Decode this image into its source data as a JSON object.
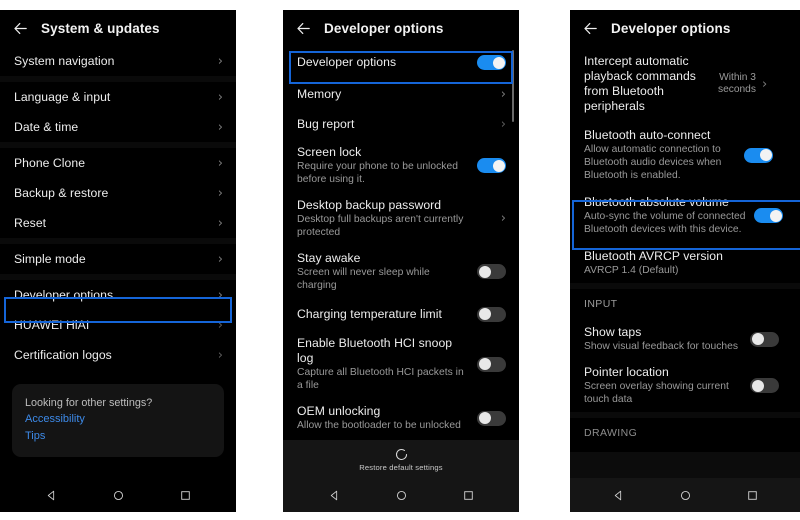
{
  "theme": {
    "accent_blue": "#1a8cf0",
    "highlight_border": "#1565d8",
    "link_blue": "#3d8ae8",
    "background": "#000000",
    "toggle_off": "#3a3a3a"
  },
  "panel1": {
    "header": {
      "back_icon": "back-arrow-icon",
      "title": "System & updates"
    },
    "groups": [
      {
        "items": [
          {
            "title": "System navigation",
            "accessory": "chevron"
          }
        ]
      },
      {
        "items": [
          {
            "title": "Language & input",
            "accessory": "chevron"
          },
          {
            "title": "Date & time",
            "accessory": "chevron"
          }
        ]
      },
      {
        "items": [
          {
            "title": "Phone Clone",
            "accessory": "chevron"
          },
          {
            "title": "Backup & restore",
            "accessory": "chevron"
          },
          {
            "title": "Reset",
            "accessory": "chevron"
          }
        ]
      },
      {
        "items": [
          {
            "title": "Simple mode",
            "accessory": "chevron"
          }
        ]
      },
      {
        "items": [
          {
            "title": "Developer options",
            "accessory": "chevron",
            "highlighted": true
          },
          {
            "title": "HUAWEI HiAI",
            "accessory": "chevron"
          },
          {
            "title": "Certification logos",
            "accessory": "chevron"
          }
        ]
      }
    ],
    "card": {
      "question": "Looking for other settings?",
      "links": [
        "Accessibility",
        "Tips"
      ]
    },
    "navbar": {
      "back": "nav-back-icon",
      "home": "nav-home-icon",
      "recents": "nav-recents-icon"
    }
  },
  "panel2": {
    "header": {
      "back_icon": "back-arrow-icon",
      "title": "Developer options"
    },
    "rows": [
      {
        "title": "Developer options",
        "sub": "",
        "control": "toggle",
        "state": "on",
        "highlighted": true
      },
      {
        "title": "Memory",
        "sub": "",
        "control": "chevron"
      },
      {
        "title": "Bug report",
        "sub": "",
        "control": "chevron-dim"
      },
      {
        "title": "Screen lock",
        "sub": "Require your phone to be unlocked before using it.",
        "control": "toggle",
        "state": "on"
      },
      {
        "title": "Desktop backup password",
        "sub": "Desktop full backups aren't currently protected",
        "control": "chevron"
      },
      {
        "title": "Stay awake",
        "sub": "Screen will never sleep while charging",
        "control": "toggle",
        "state": "off"
      },
      {
        "title": "Charging temperature limit",
        "sub": "",
        "control": "toggle",
        "state": "off"
      },
      {
        "title": "Enable Bluetooth HCI snoop log",
        "sub": "Capture all Bluetooth HCI packets in a file",
        "control": "toggle",
        "state": "off"
      },
      {
        "title": "OEM unlocking",
        "sub": "Allow the bootloader to be unlocked",
        "control": "toggle",
        "state": "off"
      }
    ],
    "restore": {
      "icon": "restore-circular-arrow-icon",
      "label": "Restore default settings"
    },
    "navbar": {
      "back": "nav-back-icon",
      "home": "nav-home-icon",
      "recents": "nav-recents-icon"
    }
  },
  "panel3": {
    "header": {
      "back_icon": "back-arrow-icon",
      "title": "Developer options"
    },
    "rows": [
      {
        "title": "Intercept automatic playback commands from Bluetooth peripherals",
        "sub": "",
        "control": "value-chevron",
        "value": "Within 3\nseconds"
      },
      {
        "title": "Bluetooth auto-connect",
        "sub": "Allow automatic connection to Bluetooth audio devices when Bluetooth is enabled.",
        "control": "toggle",
        "state": "on"
      },
      {
        "title": "Bluetooth absolute volume",
        "sub": "Auto-sync the volume of connected Bluetooth devices with this device.",
        "control": "toggle",
        "state": "on",
        "highlighted": true
      },
      {
        "title": "Bluetooth AVRCP version",
        "sub": "AVRCP 1.4 (Default)",
        "control": "none"
      }
    ],
    "section_input": "INPUT",
    "input_rows": [
      {
        "title": "Show taps",
        "sub": "Show visual feedback for touches",
        "control": "toggle",
        "state": "off"
      },
      {
        "title": "Pointer location",
        "sub": "Screen overlay showing current touch data",
        "control": "toggle",
        "state": "off"
      }
    ],
    "section_drawing": "DRAWING",
    "navbar": {
      "back": "nav-back-icon",
      "home": "nav-home-icon",
      "recents": "nav-recents-icon"
    }
  }
}
